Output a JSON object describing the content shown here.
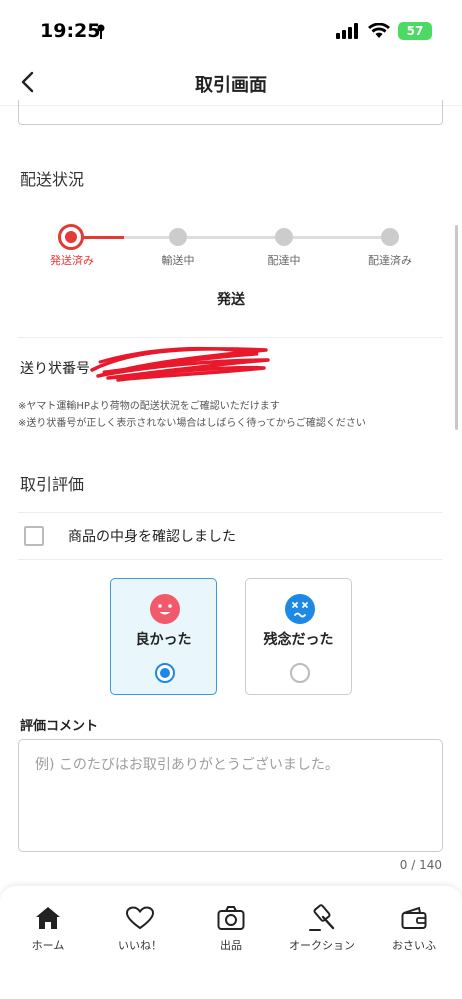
{
  "status_bar": {
    "time": "19:25",
    "battery": "57"
  },
  "nav": {
    "title": "取引画面"
  },
  "shipping": {
    "section_title": "配送状況",
    "steps": [
      "発送済み",
      "輸送中",
      "配達中",
      "配達済み"
    ],
    "current_status": "発送",
    "tracking_label": "送り状番号",
    "notes": [
      "※ヤマト運輸HPより荷物の配送状況をご確認いただけます",
      "※送り状番号が正しく表示されない場合はしばらく待ってからご確認ください"
    ]
  },
  "review": {
    "section_title": "取引評価",
    "checkbox_label": "商品の中身を確認しました",
    "options": [
      {
        "label": "良かった",
        "selected": true,
        "icon": "smile-face-icon",
        "color": "#f25a6b"
      },
      {
        "label": "残念だった",
        "selected": false,
        "icon": "sad-face-icon",
        "color": "#1e88e5"
      }
    ],
    "comment_label": "評価コメント",
    "comment_placeholder": "例) このたびはお取引ありがとうございました。",
    "char_count": "0 / 140"
  },
  "tabs": [
    {
      "label": "ホーム",
      "icon": "home-icon"
    },
    {
      "label": "いいね！",
      "icon": "heart-icon"
    },
    {
      "label": "出品",
      "icon": "camera-icon"
    },
    {
      "label": "オークション",
      "icon": "gavel-icon"
    },
    {
      "label": "おさいふ",
      "icon": "wallet-icon"
    }
  ],
  "colors": {
    "accent_red": "#e53935",
    "selected_blue": "#1e88e5",
    "battery_green": "#4cd964"
  }
}
